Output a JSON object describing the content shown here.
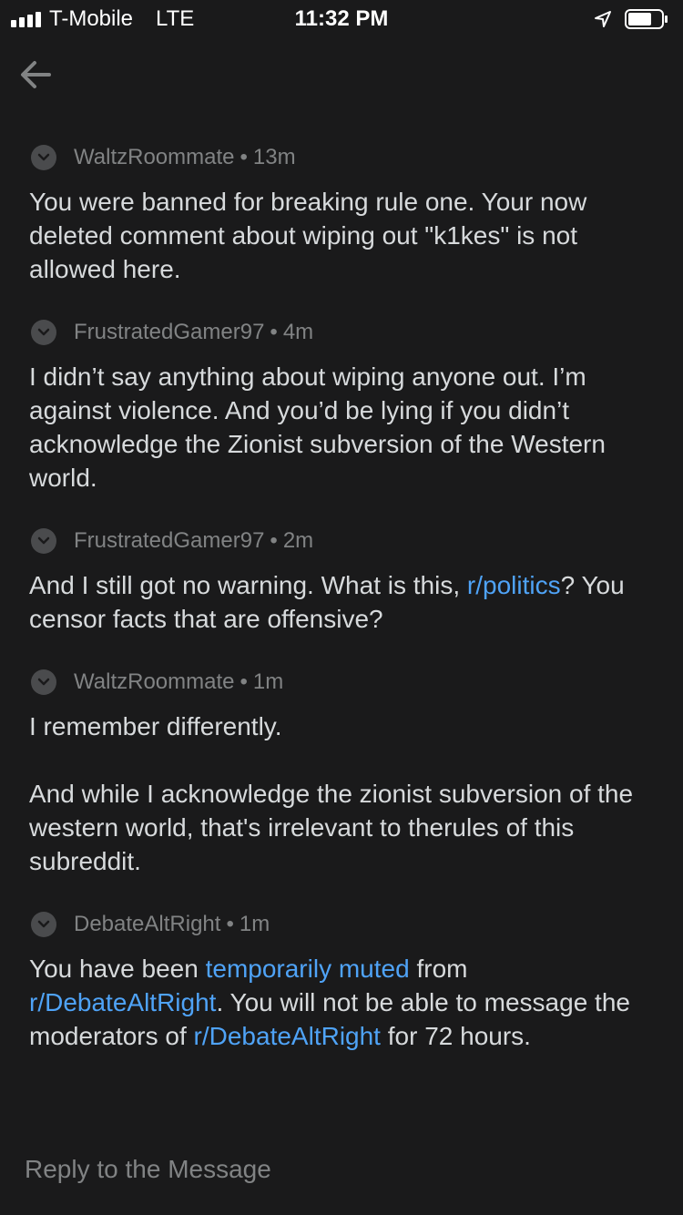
{
  "status_bar": {
    "carrier": "T-Mobile",
    "network": "LTE",
    "time": "11:32 PM",
    "icons": [
      "signal-icon",
      "location-arrow-icon",
      "battery-icon"
    ]
  },
  "nav": {
    "back_icon": "arrow-left-icon"
  },
  "colors": {
    "background": "#1a1a1b",
    "text": "#d7dadc",
    "meta": "#818384",
    "link": "#4fa3f7"
  },
  "messages": [
    {
      "author": "WaltzRoommate",
      "time": "13m",
      "body": [
        "You were banned for breaking rule one. Your now deleted comment about wiping out \"k1kes\" is not allowed here."
      ]
    },
    {
      "author": "FrustratedGamer97",
      "time": "4m",
      "body": [
        "I didn’t say anything about wiping anyone out. I’m against violence. And you’d be lying if you didn’t acknowledge the Zionist subversion of the Western world."
      ]
    },
    {
      "author": "FrustratedGamer97",
      "time": "2m",
      "body_parts": {
        "before": "And I still got no warning. What is this, ",
        "link": "r/politics",
        "after": "? You censor facts that are offensive?"
      }
    },
    {
      "author": "WaltzRoommate",
      "time": "1m",
      "body": [
        "I remember differently.",
        "And while I acknowledge the zionist subversion of the western world, that's irrelevant to therules of this subreddit."
      ]
    },
    {
      "author": "DebateAltRight",
      "time": "1m",
      "body_parts": {
        "t1": "You have been ",
        "link1": "temporarily muted",
        "t2": " from ",
        "link2": "r/DebateAltRight",
        "t3": ". You will not be able to message the moderators of ",
        "link3": "r/DebateAltRight",
        "t4": " for 72 hours."
      }
    }
  ],
  "reply": {
    "placeholder": "Reply to the Message"
  }
}
